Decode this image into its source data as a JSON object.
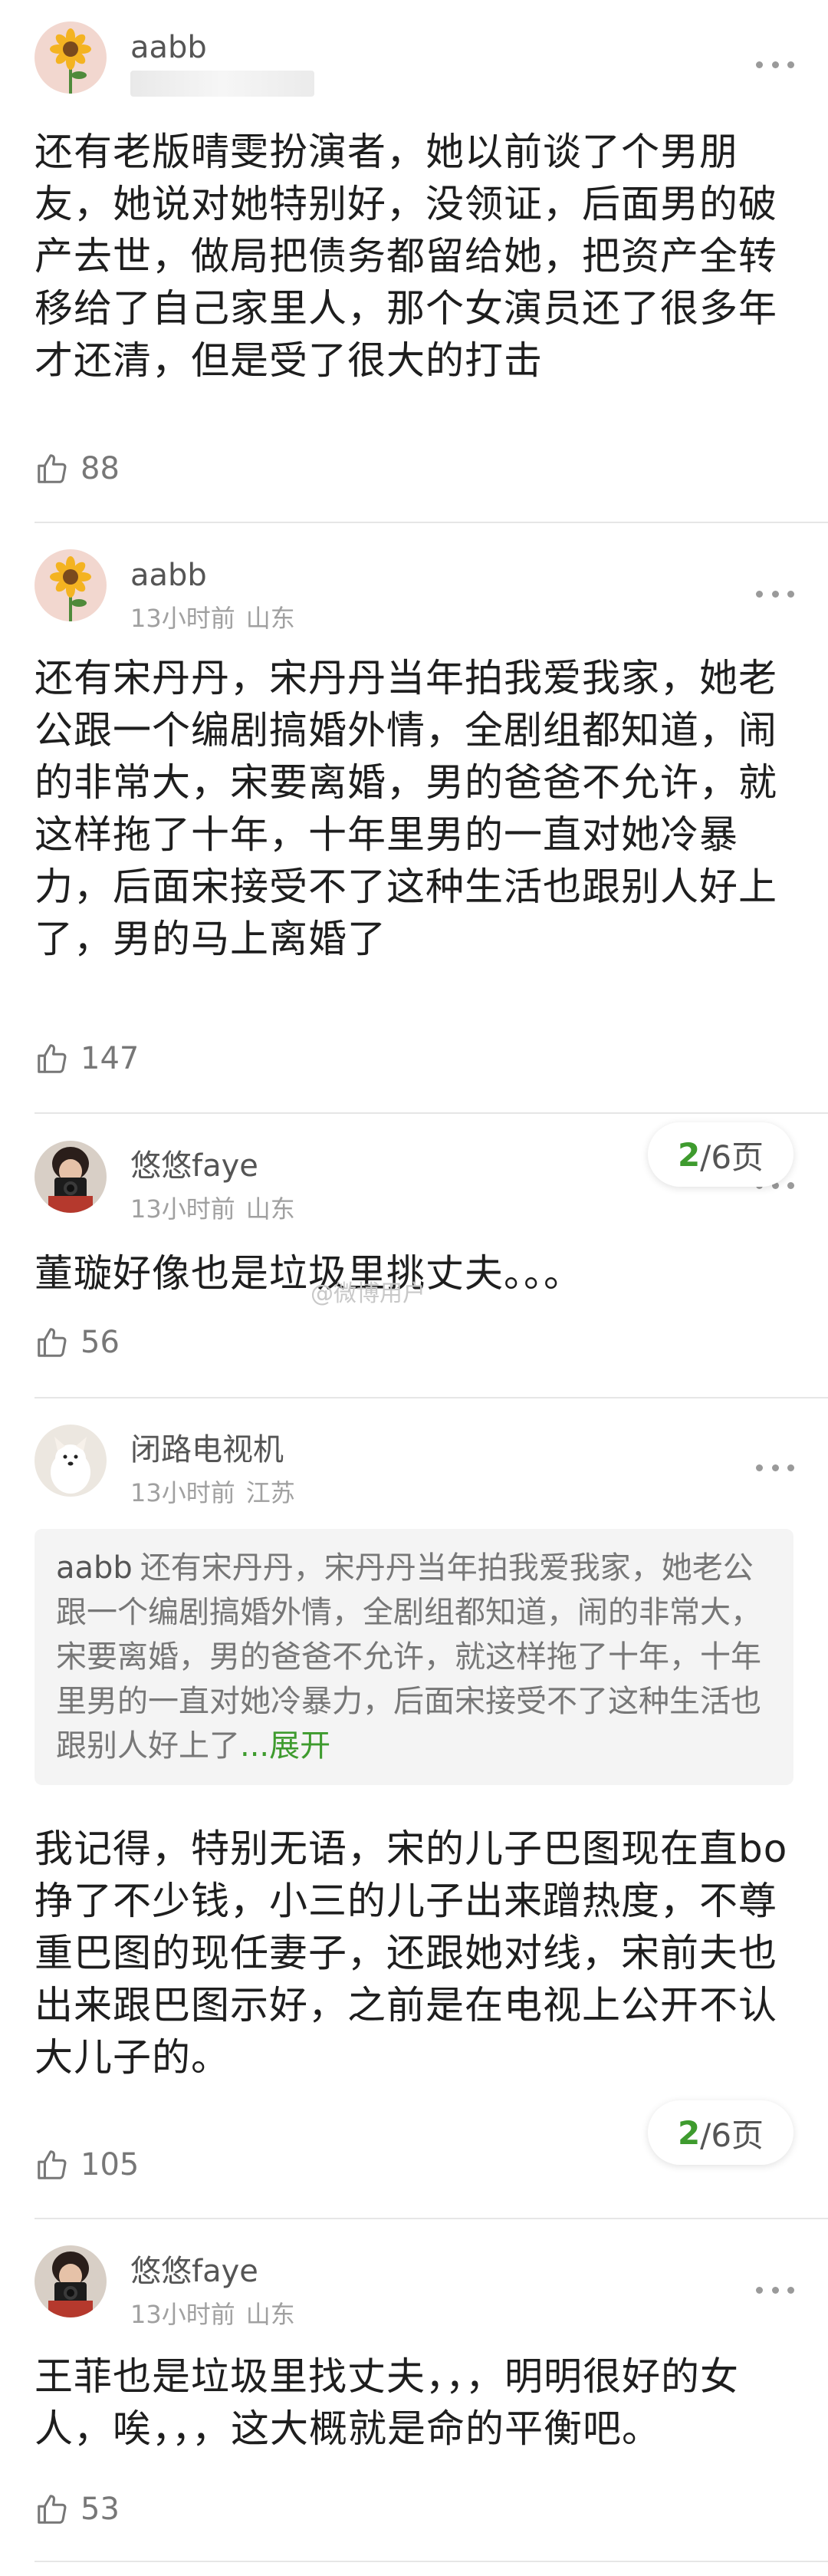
{
  "comments": [
    {
      "username": "aabb",
      "body": "还有老版晴雯扮演者，她以前谈了个男朋友，她说对她特别好，没领证，后面男的破产去世，做局把债务都留给她，把资产全转移给了自己家里人，那个女演员还了很多年才还清，但是受了很大的打击",
      "likes": "88"
    },
    {
      "username": "aabb",
      "time": "13小时前",
      "location": "山东",
      "body": "还有宋丹丹，宋丹丹当年拍我爱我家，她老公跟一个编剧搞婚外情，全剧组都知道，闹的非常大，宋要离婚，男的爸爸不允许，就这样拖了十年，十年里男的一直对她冷暴力，后面宋接受不了这种生活也跟别人好上了，男的马上离婚了",
      "likes": "147"
    },
    {
      "username": "悠悠faye",
      "time": "13小时前",
      "location": "山东",
      "body": "董璇好像也是垃圾里挑丈夫。。。",
      "likes": "56"
    },
    {
      "username": "闭路电视机",
      "time": "13小时前",
      "location": "江苏",
      "quote_name": "aabb",
      "quote_text": "还有宋丹丹，宋丹丹当年拍我爱我家，她老公跟一个编剧搞婚外情，全剧组都知道，闹的非常大，宋要离婚，男的爸爸不允许，就这样拖了十年，十年里男的一直对她冷暴力，后面宋接受不了这种生活也跟别人好上了",
      "quote_expand": "...展开",
      "body": "我记得，特别无语，宋的儿子巴图现在直bo挣了不少钱，小三的儿子出来蹭热度，不尊重巴图的现任妻子，还跟她对线，宋前夫也出来跟巴图示好，之前是在电视上公开不认大儿子的。",
      "likes": "105"
    },
    {
      "username": "悠悠faye",
      "time": "13小时前",
      "location": "山东",
      "body": "王菲也是垃圾里找丈夫，，，明明很好的女人，唉，，，这大概就是命的平衡吧。",
      "likes": "53"
    }
  ],
  "page_indicator": {
    "current": "2",
    "total": "/6页"
  },
  "watermark": "@微博用户",
  "colors": {
    "accent_green": "#3e9b2e",
    "meta_gray": "#a0a0a0",
    "divider": "#e6e6e6"
  },
  "icons": [
    "sunflower-avatar",
    "camera-girl-avatar",
    "white-dog-avatar",
    "more-dots-icon",
    "thumbs-up-icon"
  ]
}
